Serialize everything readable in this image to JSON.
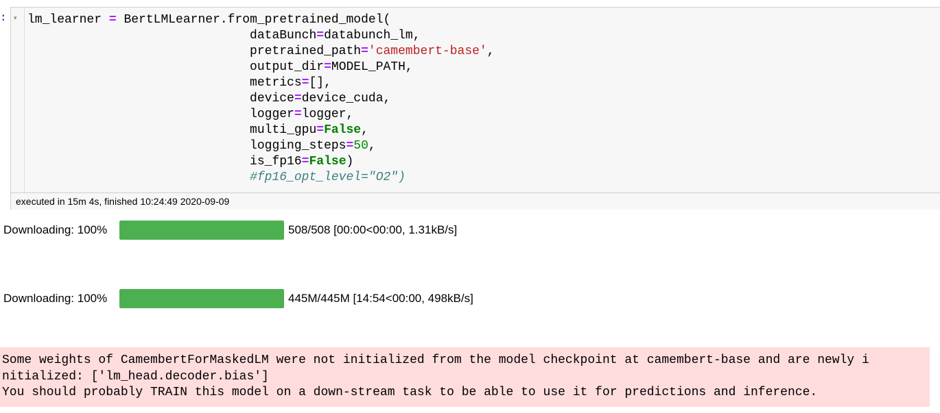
{
  "cell": {
    "prompt": ":",
    "code_lines": [
      [
        {
          "t": "lm_learner "
        },
        {
          "t": "=",
          "c": "op"
        },
        {
          "t": " BertLMLearner.from_pretrained_model("
        }
      ],
      [
        {
          "t": "                              dataBunch"
        },
        {
          "t": "=",
          "c": "op"
        },
        {
          "t": "databunch_lm,"
        }
      ],
      [
        {
          "t": "                              pretrained_path"
        },
        {
          "t": "=",
          "c": "op"
        },
        {
          "t": "'camembert-base'",
          "c": "str"
        },
        {
          "t": ","
        }
      ],
      [
        {
          "t": "                              output_dir"
        },
        {
          "t": "=",
          "c": "op"
        },
        {
          "t": "MODEL_PATH,"
        }
      ],
      [
        {
          "t": "                              metrics"
        },
        {
          "t": "=",
          "c": "op"
        },
        {
          "t": "[],"
        }
      ],
      [
        {
          "t": "                              device"
        },
        {
          "t": "=",
          "c": "op"
        },
        {
          "t": "device_cuda,"
        }
      ],
      [
        {
          "t": "                              logger"
        },
        {
          "t": "=",
          "c": "op"
        },
        {
          "t": "logger,"
        }
      ],
      [
        {
          "t": "                              multi_gpu"
        },
        {
          "t": "=",
          "c": "op"
        },
        {
          "t": "False",
          "c": "kw"
        },
        {
          "t": ","
        }
      ],
      [
        {
          "t": "                              logging_steps"
        },
        {
          "t": "=",
          "c": "op"
        },
        {
          "t": "50",
          "c": "num"
        },
        {
          "t": ","
        }
      ],
      [
        {
          "t": "                              is_fp16"
        },
        {
          "t": "=",
          "c": "op"
        },
        {
          "t": "False",
          "c": "kw"
        },
        {
          "t": ")"
        }
      ],
      [
        {
          "t": "                              "
        },
        {
          "t": "#fp16_opt_level=\"O2\")",
          "c": "cm"
        }
      ]
    ],
    "execution_info": "executed in 15m 4s, finished 10:24:49 2020-09-09"
  },
  "outputs": {
    "progress_bars": [
      {
        "label": "Downloading: 100%",
        "fraction": 1.0,
        "info": "508/508 [00:00<00:00, 1.31kB/s]"
      },
      {
        "label": "Downloading: 100%",
        "fraction": 1.0,
        "info": "445M/445M [14:54<00:00, 498kB/s]"
      }
    ],
    "stderr_lines": [
      "Some weights of CamembertForMaskedLM were not initialized from the model checkpoint at camembert-base and are newly i",
      "nitialized: ['lm_head.decoder.bias']",
      "You should probably TRAIN this model on a down-stream task to be able to use it for predictions and inference."
    ]
  },
  "icons": {
    "fold_arrow": "▾"
  },
  "colors": {
    "progress_fill": "#4caf50",
    "stderr_background": "#ffdddd",
    "operator": "#aa22ff",
    "string": "#ba2121",
    "keyword": "#008000",
    "comment": "#408080"
  }
}
